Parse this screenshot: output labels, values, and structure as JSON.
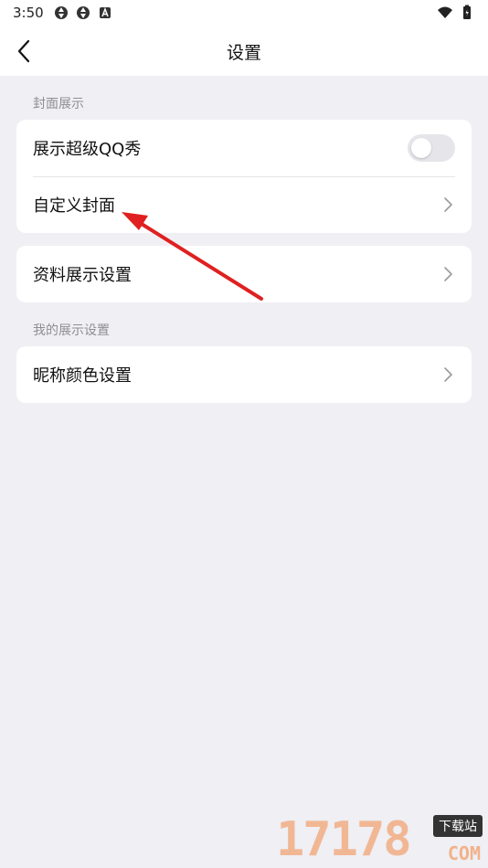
{
  "status_bar": {
    "time": "3:50",
    "icons_left": [
      "sync-icon",
      "sync-icon",
      "a-badge-icon"
    ],
    "icons_right": [
      "wifi-icon",
      "battery-icon"
    ]
  },
  "nav": {
    "title": "设置",
    "back_icon": "chevron-left-icon"
  },
  "sections": [
    {
      "label": "封面展示",
      "rows": [
        {
          "label": "展示超级QQ秀",
          "control": "toggle",
          "toggle_on": false
        },
        {
          "label": "自定义封面",
          "control": "chevron"
        }
      ]
    },
    {
      "label": "",
      "rows": [
        {
          "label": "资料展示设置",
          "control": "chevron"
        }
      ]
    },
    {
      "label": "我的展示设置",
      "rows": [
        {
          "label": "昵称颜色设置",
          "control": "chevron"
        }
      ]
    }
  ],
  "annotation": {
    "color": "#e02020",
    "points_to": "自定义封面"
  },
  "watermark": {
    "number": "17178",
    "badge": "下载站",
    "suffix": "COM"
  },
  "colors": {
    "background": "#efeff4",
    "card": "#ffffff",
    "secondary_text": "#8e8e93"
  }
}
